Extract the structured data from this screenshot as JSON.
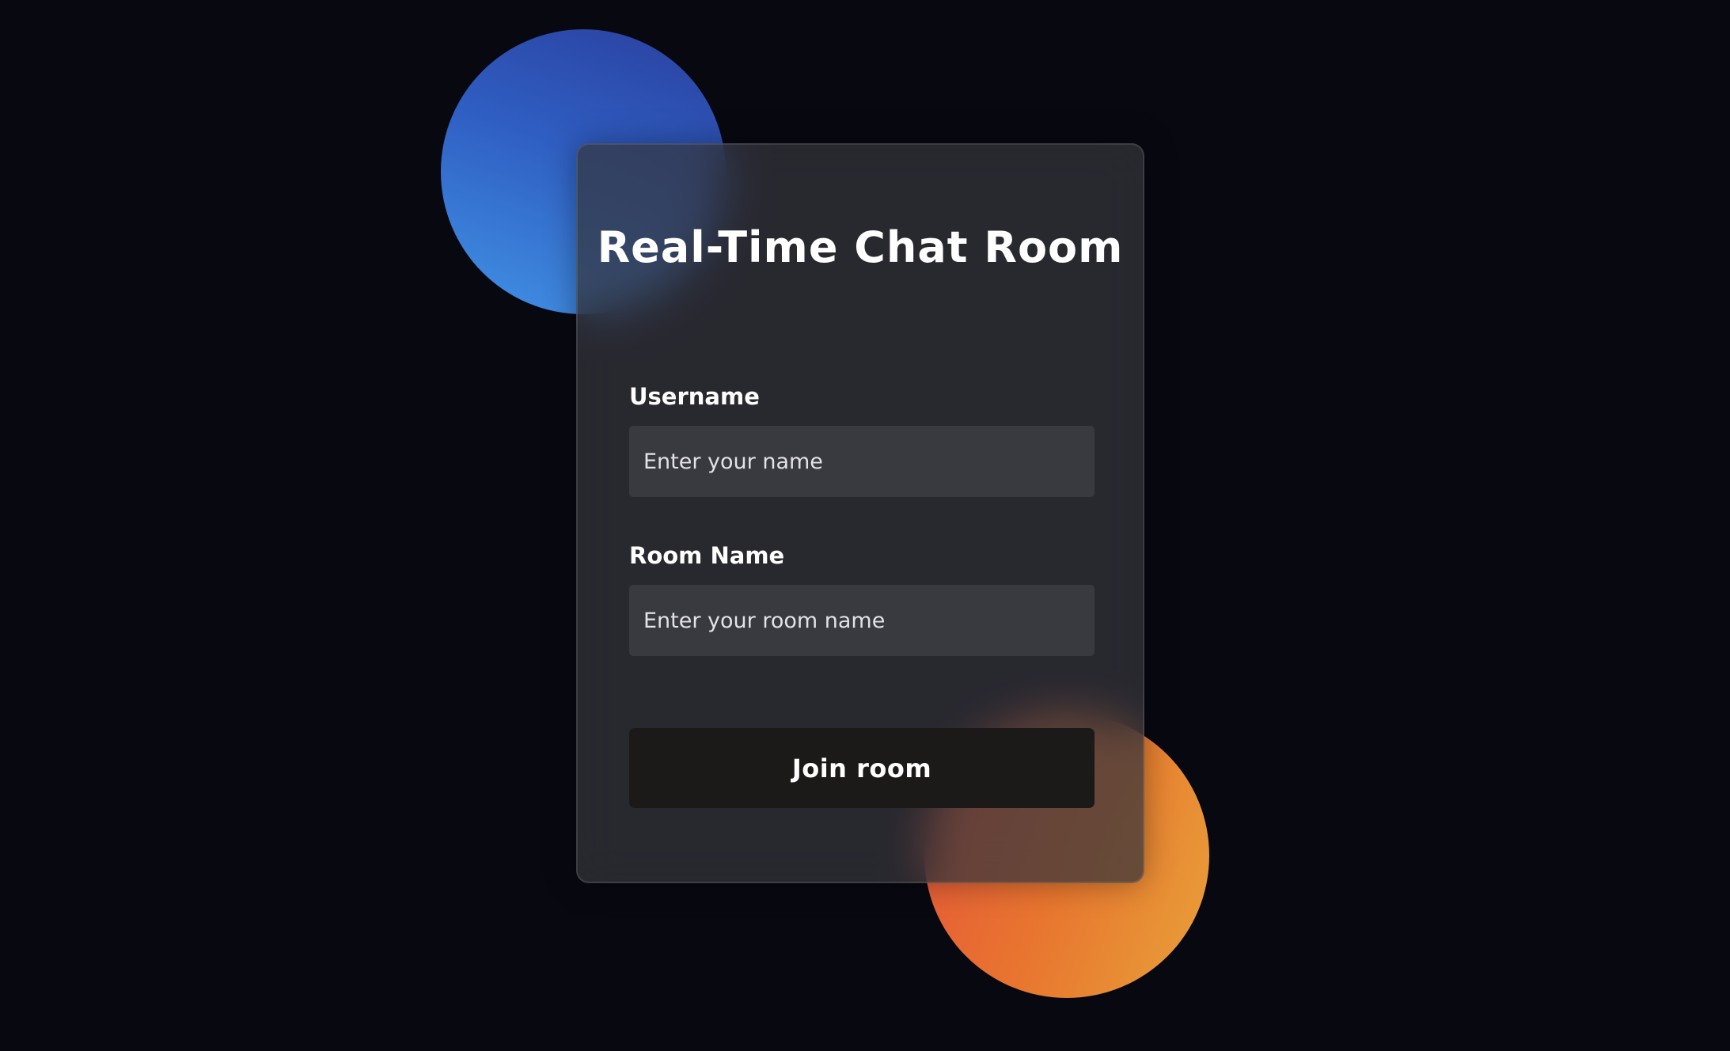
{
  "page": {
    "background_color": "#080811"
  },
  "decor": {
    "blue_blob_color": "#2f5ec2",
    "orange_blob_color": "#e8762f"
  },
  "card": {
    "title": "Real-Time Chat Room",
    "username": {
      "label": "Username",
      "value": "",
      "placeholder": "Enter your name"
    },
    "room_name": {
      "label": "Room Name",
      "value": "",
      "placeholder": "Enter your room name"
    },
    "join_button": {
      "label": "Join room"
    }
  }
}
